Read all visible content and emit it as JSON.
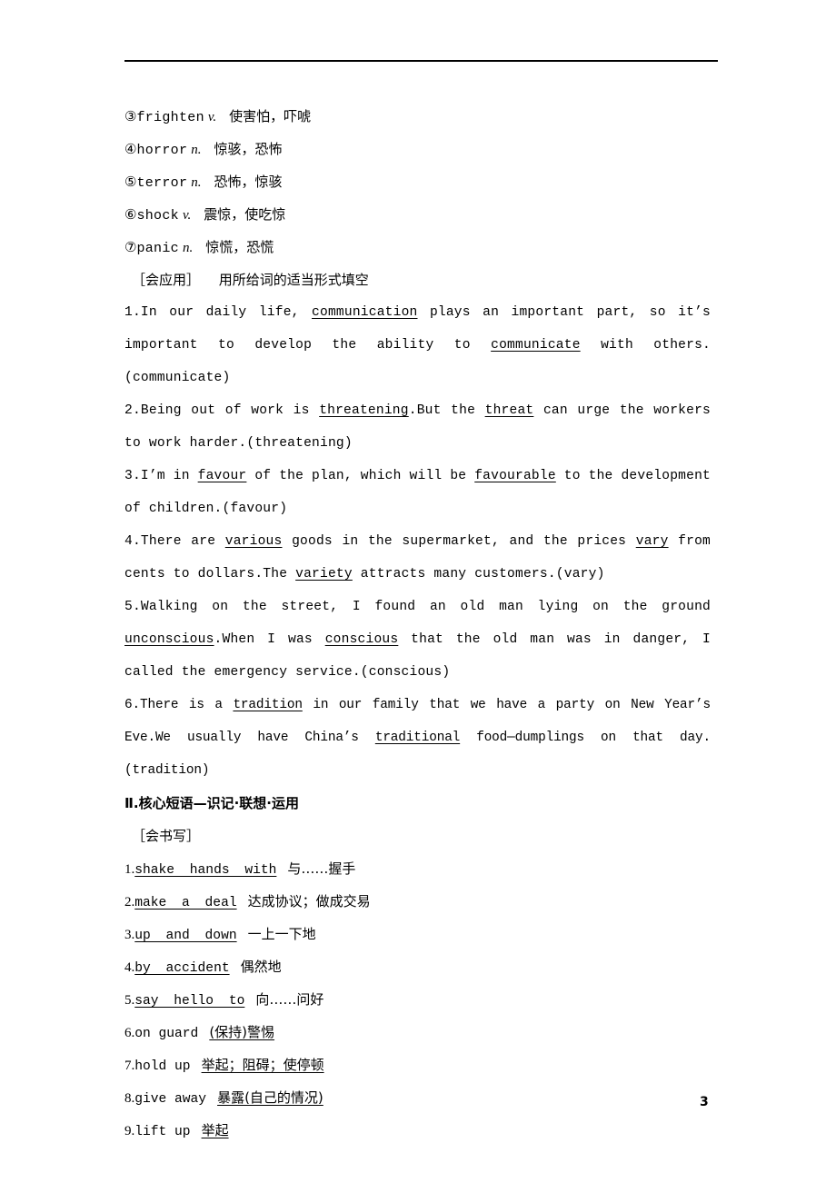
{
  "page": {
    "number": "3"
  },
  "vocabulary": [
    {
      "marker": "③",
      "word": "frighten",
      "pos": "v.",
      "meaning": "使害怕，吓唬"
    },
    {
      "marker": "④",
      "word": "horror",
      "pos": "n.",
      "meaning": "惊骇，恐怖"
    },
    {
      "marker": "⑤",
      "word": "terror",
      "pos": "n.",
      "meaning": "恐怖，惊骇"
    },
    {
      "marker": "⑥",
      "word": "shock",
      "pos": "v.",
      "meaning": "震惊，使吃惊"
    },
    {
      "marker": "⑦",
      "word": "panic",
      "pos": "n.",
      "meaning": "惊慌，恐慌"
    }
  ],
  "apply_section": {
    "label": "［会应用］",
    "instruction": "用所给词的适当形式填空",
    "items": [
      {
        "number": "1.",
        "parts": [
          {
            "t": "In our daily life, ",
            "u": false
          },
          {
            "t": "communication",
            "u": true
          },
          {
            "t": " plays an important part, so it’s important to develop the ability to ",
            "u": false
          },
          {
            "t": "communicate",
            "u": true
          },
          {
            "t": " with others.(communicate)",
            "u": false
          }
        ]
      },
      {
        "number": "2.",
        "parts": [
          {
            "t": "Being out of work is ",
            "u": false
          },
          {
            "t": "threatening",
            "u": true
          },
          {
            "t": ".But the ",
            "u": false
          },
          {
            "t": "threat",
            "u": true
          },
          {
            "t": " can urge the workers to work harder.(threatening)",
            "u": false
          }
        ]
      },
      {
        "number": "3.",
        "parts": [
          {
            "t": "I’m in ",
            "u": false
          },
          {
            "t": "favour",
            "u": true
          },
          {
            "t": " of the plan, which will be ",
            "u": false
          },
          {
            "t": "favourable",
            "u": true
          },
          {
            "t": " to the development of children.(favour)",
            "u": false
          }
        ]
      },
      {
        "number": "4.",
        "parts": [
          {
            "t": "There are ",
            "u": false
          },
          {
            "t": "various",
            "u": true
          },
          {
            "t": " goods in the supermarket, and the prices ",
            "u": false
          },
          {
            "t": "vary",
            "u": true
          },
          {
            "t": " from cents to dollars.The ",
            "u": false
          },
          {
            "t": "variety",
            "u": true
          },
          {
            "t": " attracts many customers.(vary)",
            "u": false
          }
        ]
      },
      {
        "number": "5.",
        "parts": [
          {
            "t": "Walking on the street, I found an old man lying on the ground ",
            "u": false
          },
          {
            "t": "unconscious",
            "u": true
          },
          {
            "t": ".When I was ",
            "u": false
          },
          {
            "t": "conscious",
            "u": true
          },
          {
            "t": " that the old man was in danger, I called the emergency service.(conscious)",
            "u": false
          }
        ]
      },
      {
        "number": "6.",
        "tight": true,
        "parts": [
          {
            "t": "There is a ",
            "u": false
          },
          {
            "t": "tradition",
            "u": true
          },
          {
            "t": " in our family that we have a party on New Year’s Eve.We usually have China’s ",
            "u": false
          },
          {
            "t": "traditional",
            "u": true
          },
          {
            "t": " food—dumplings on that day.(tradition)",
            "u": false
          }
        ]
      }
    ]
  },
  "phrase_section": {
    "heading": "Ⅱ.核心短语—识记·联想·运用",
    "write_label": "［会书写］",
    "items": [
      {
        "number": "1.",
        "english": "shake hands with",
        "english_underlined": true,
        "chinese": "与……握手",
        "chinese_underlined": false
      },
      {
        "number": "2.",
        "english": "make a deal",
        "english_underlined": true,
        "chinese": "达成协议；做成交易",
        "chinese_underlined": false
      },
      {
        "number": "3.",
        "english": "up and down",
        "english_underlined": true,
        "chinese": "一上一下地",
        "chinese_underlined": false
      },
      {
        "number": "4.",
        "english": "by accident",
        "english_underlined": true,
        "chinese": "偶然地",
        "chinese_underlined": false
      },
      {
        "number": "5.",
        "english": "say hello to",
        "english_underlined": true,
        "chinese": "向……问好",
        "chinese_underlined": false
      },
      {
        "number": "6.",
        "english": "on guard",
        "english_underlined": false,
        "chinese": "(保持)警惕",
        "chinese_underlined": true
      },
      {
        "number": "7.",
        "english": "hold up",
        "english_underlined": false,
        "chinese": "举起；阻碍；使停顿",
        "chinese_underlined": true
      },
      {
        "number": "8.",
        "english": "give away",
        "english_underlined": false,
        "chinese": "暴露(自己的情况)",
        "chinese_underlined": true
      },
      {
        "number": "9.",
        "english": "lift up",
        "english_underlined": false,
        "chinese": "举起",
        "chinese_underlined": true
      }
    ]
  }
}
